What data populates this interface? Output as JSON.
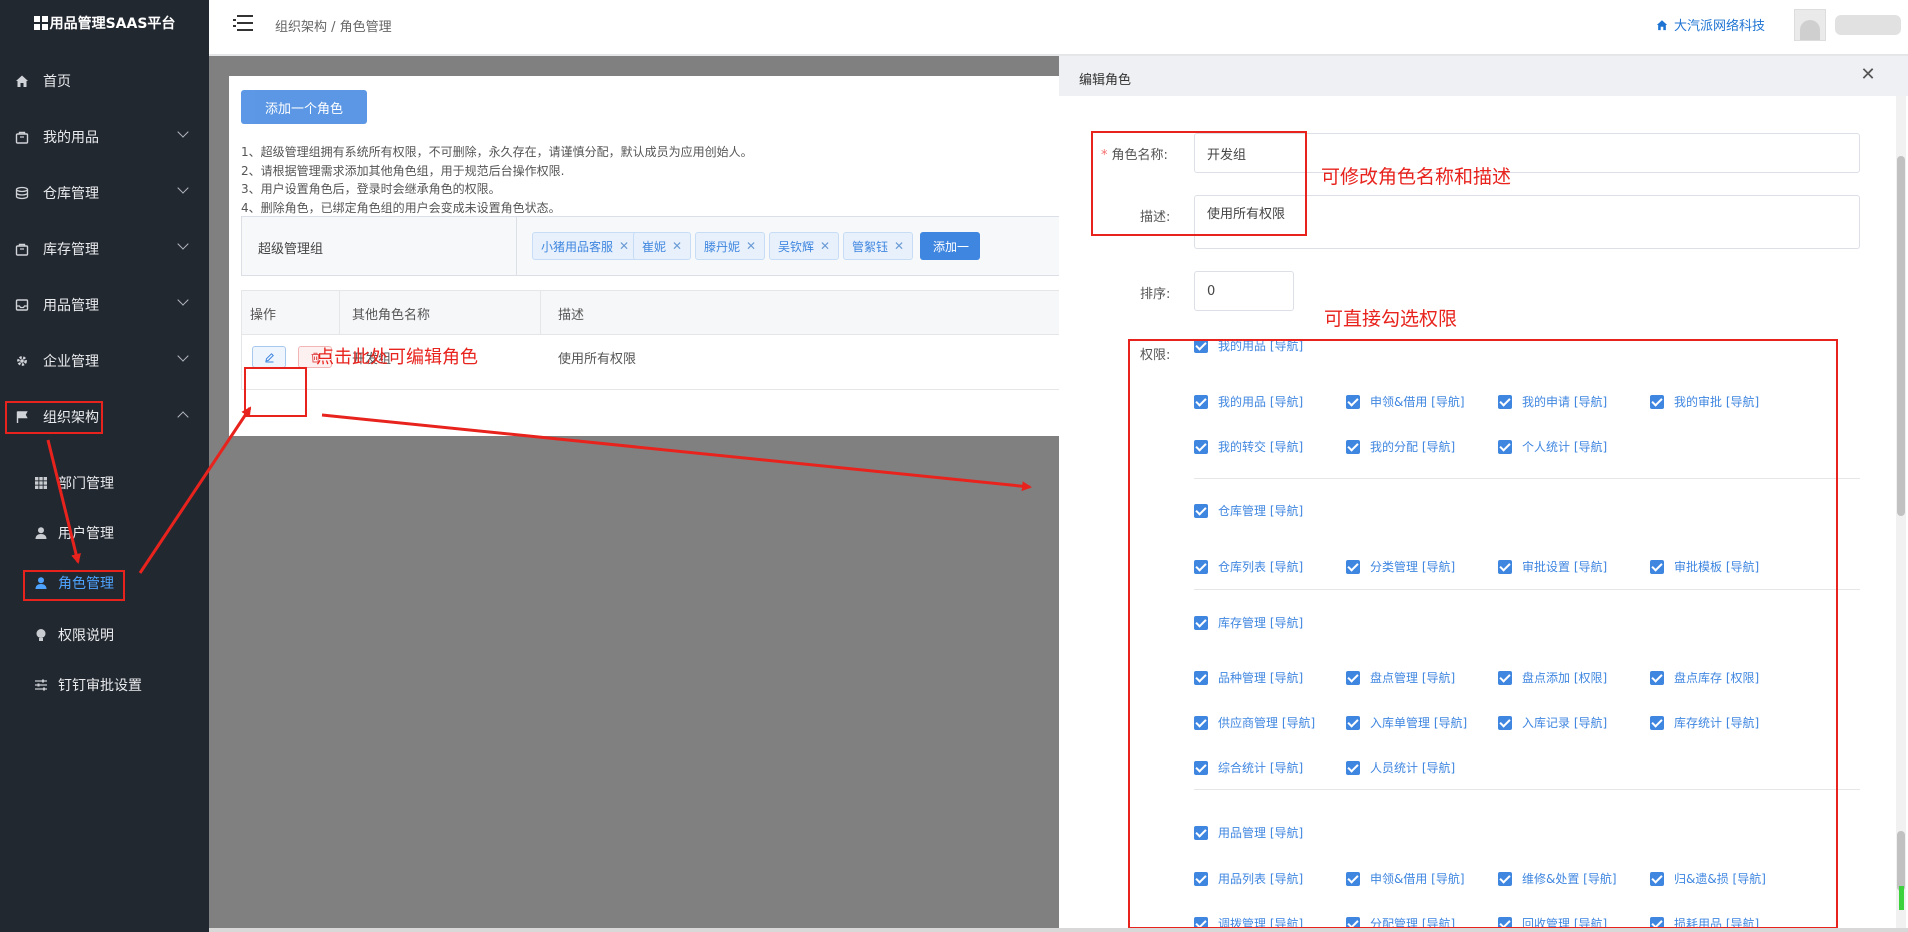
{
  "app": {
    "title": "用品管理SAAS平台"
  },
  "sidebar": {
    "items": [
      {
        "label": "首页",
        "icon": "home-icon"
      },
      {
        "label": "我的用品",
        "icon": "bag-icon"
      },
      {
        "label": "仓库管理",
        "icon": "database-icon"
      },
      {
        "label": "库存管理",
        "icon": "bag-icon"
      },
      {
        "label": "用品管理",
        "icon": "inbox-icon"
      },
      {
        "label": "企业管理",
        "icon": "gear-icon"
      },
      {
        "label": "组织架构",
        "icon": "flag-icon"
      }
    ],
    "subitems": [
      {
        "label": "部门管理",
        "icon": "grid-icon"
      },
      {
        "label": "用户管理",
        "icon": "user-icon"
      },
      {
        "label": "角色管理",
        "icon": "user-icon"
      },
      {
        "label": "权限说明",
        "icon": "bulb-icon"
      },
      {
        "label": "钉钉审批设置",
        "icon": "sliders-icon"
      }
    ]
  },
  "header": {
    "breadcrumb": "组织架构 / 角色管理",
    "company": "大汽派网络科技"
  },
  "main": {
    "add_role_button": "添加一个角色",
    "notes": [
      "1、超级管理组拥有系统所有权限，不可删除，永久存在，请谨慎分配，默认成员为应用创始人。",
      "2、请根据管理需求添加其他角色组，用于规范后台操作权限.",
      "3、用户设置角色后，登录时会继承角色的权限。",
      "4、删除角色，已绑定角色组的用户会变成未设置角色状态。"
    ],
    "super_group": {
      "label": "超级管理组",
      "members": [
        "小猪用品客服",
        "崔妮",
        "滕丹妮",
        "吴钦辉",
        "管絮钰"
      ],
      "add_button": "添加一"
    },
    "table": {
      "headers": [
        "操作",
        "其他角色名称",
        "描述"
      ],
      "rows": [
        {
          "name": "开发组",
          "description": "使用所有权限"
        }
      ]
    }
  },
  "drawer": {
    "title": "编辑角色",
    "name_label": "角色名称:",
    "name_value": "开发组",
    "desc_label": "描述:",
    "desc_value": "使用所有权限",
    "sort_label": "排序:",
    "sort_value": "0",
    "perm_label": "权限:",
    "permissions": {
      "r0": [
        "我的用品 [导航]"
      ],
      "r1": [
        "我的用品 [导航]",
        "申领&借用 [导航]",
        "我的申请 [导航]",
        "我的审批 [导航]"
      ],
      "r2": [
        "我的转交 [导航]",
        "我的分配 [导航]",
        "个人统计 [导航]"
      ],
      "r3": [
        "仓库管理 [导航]"
      ],
      "r4": [
        "仓库列表 [导航]",
        "分类管理 [导航]",
        "审批设置 [导航]",
        "审批模板 [导航]"
      ],
      "r5": [
        "库存管理 [导航]"
      ],
      "r6": [
        "品种管理 [导航]",
        "盘点管理 [导航]",
        "盘点添加 [权限]",
        "盘点库存 [权限]"
      ],
      "r7": [
        "供应商管理 [导航]",
        "入库单管理 [导航]",
        "入库记录 [导航]",
        "库存统计 [导航]"
      ],
      "r8": [
        "综合统计 [导航]",
        "人员统计 [导航]"
      ],
      "r9": [
        "用品管理 [导航]"
      ],
      "r10": [
        "用品列表 [导航]",
        "申领&借用 [导航]",
        "维修&处置 [导航]",
        "归&遗&损 [导航]"
      ],
      "r11": [
        "调拨管理 [导航]",
        "分配管理 [导航]",
        "回收管理 [导航]",
        "损耗用品 [导航]"
      ]
    }
  },
  "annotations": {
    "click_edit": "点击此处可编辑角色",
    "modify_name": "可修改角色名称和描述",
    "select_perm": "可直接勾选权限"
  },
  "colors": {
    "accent": "#3f86e0",
    "sidebar_bg": "#222830",
    "annotation_red": "#e8231d"
  }
}
